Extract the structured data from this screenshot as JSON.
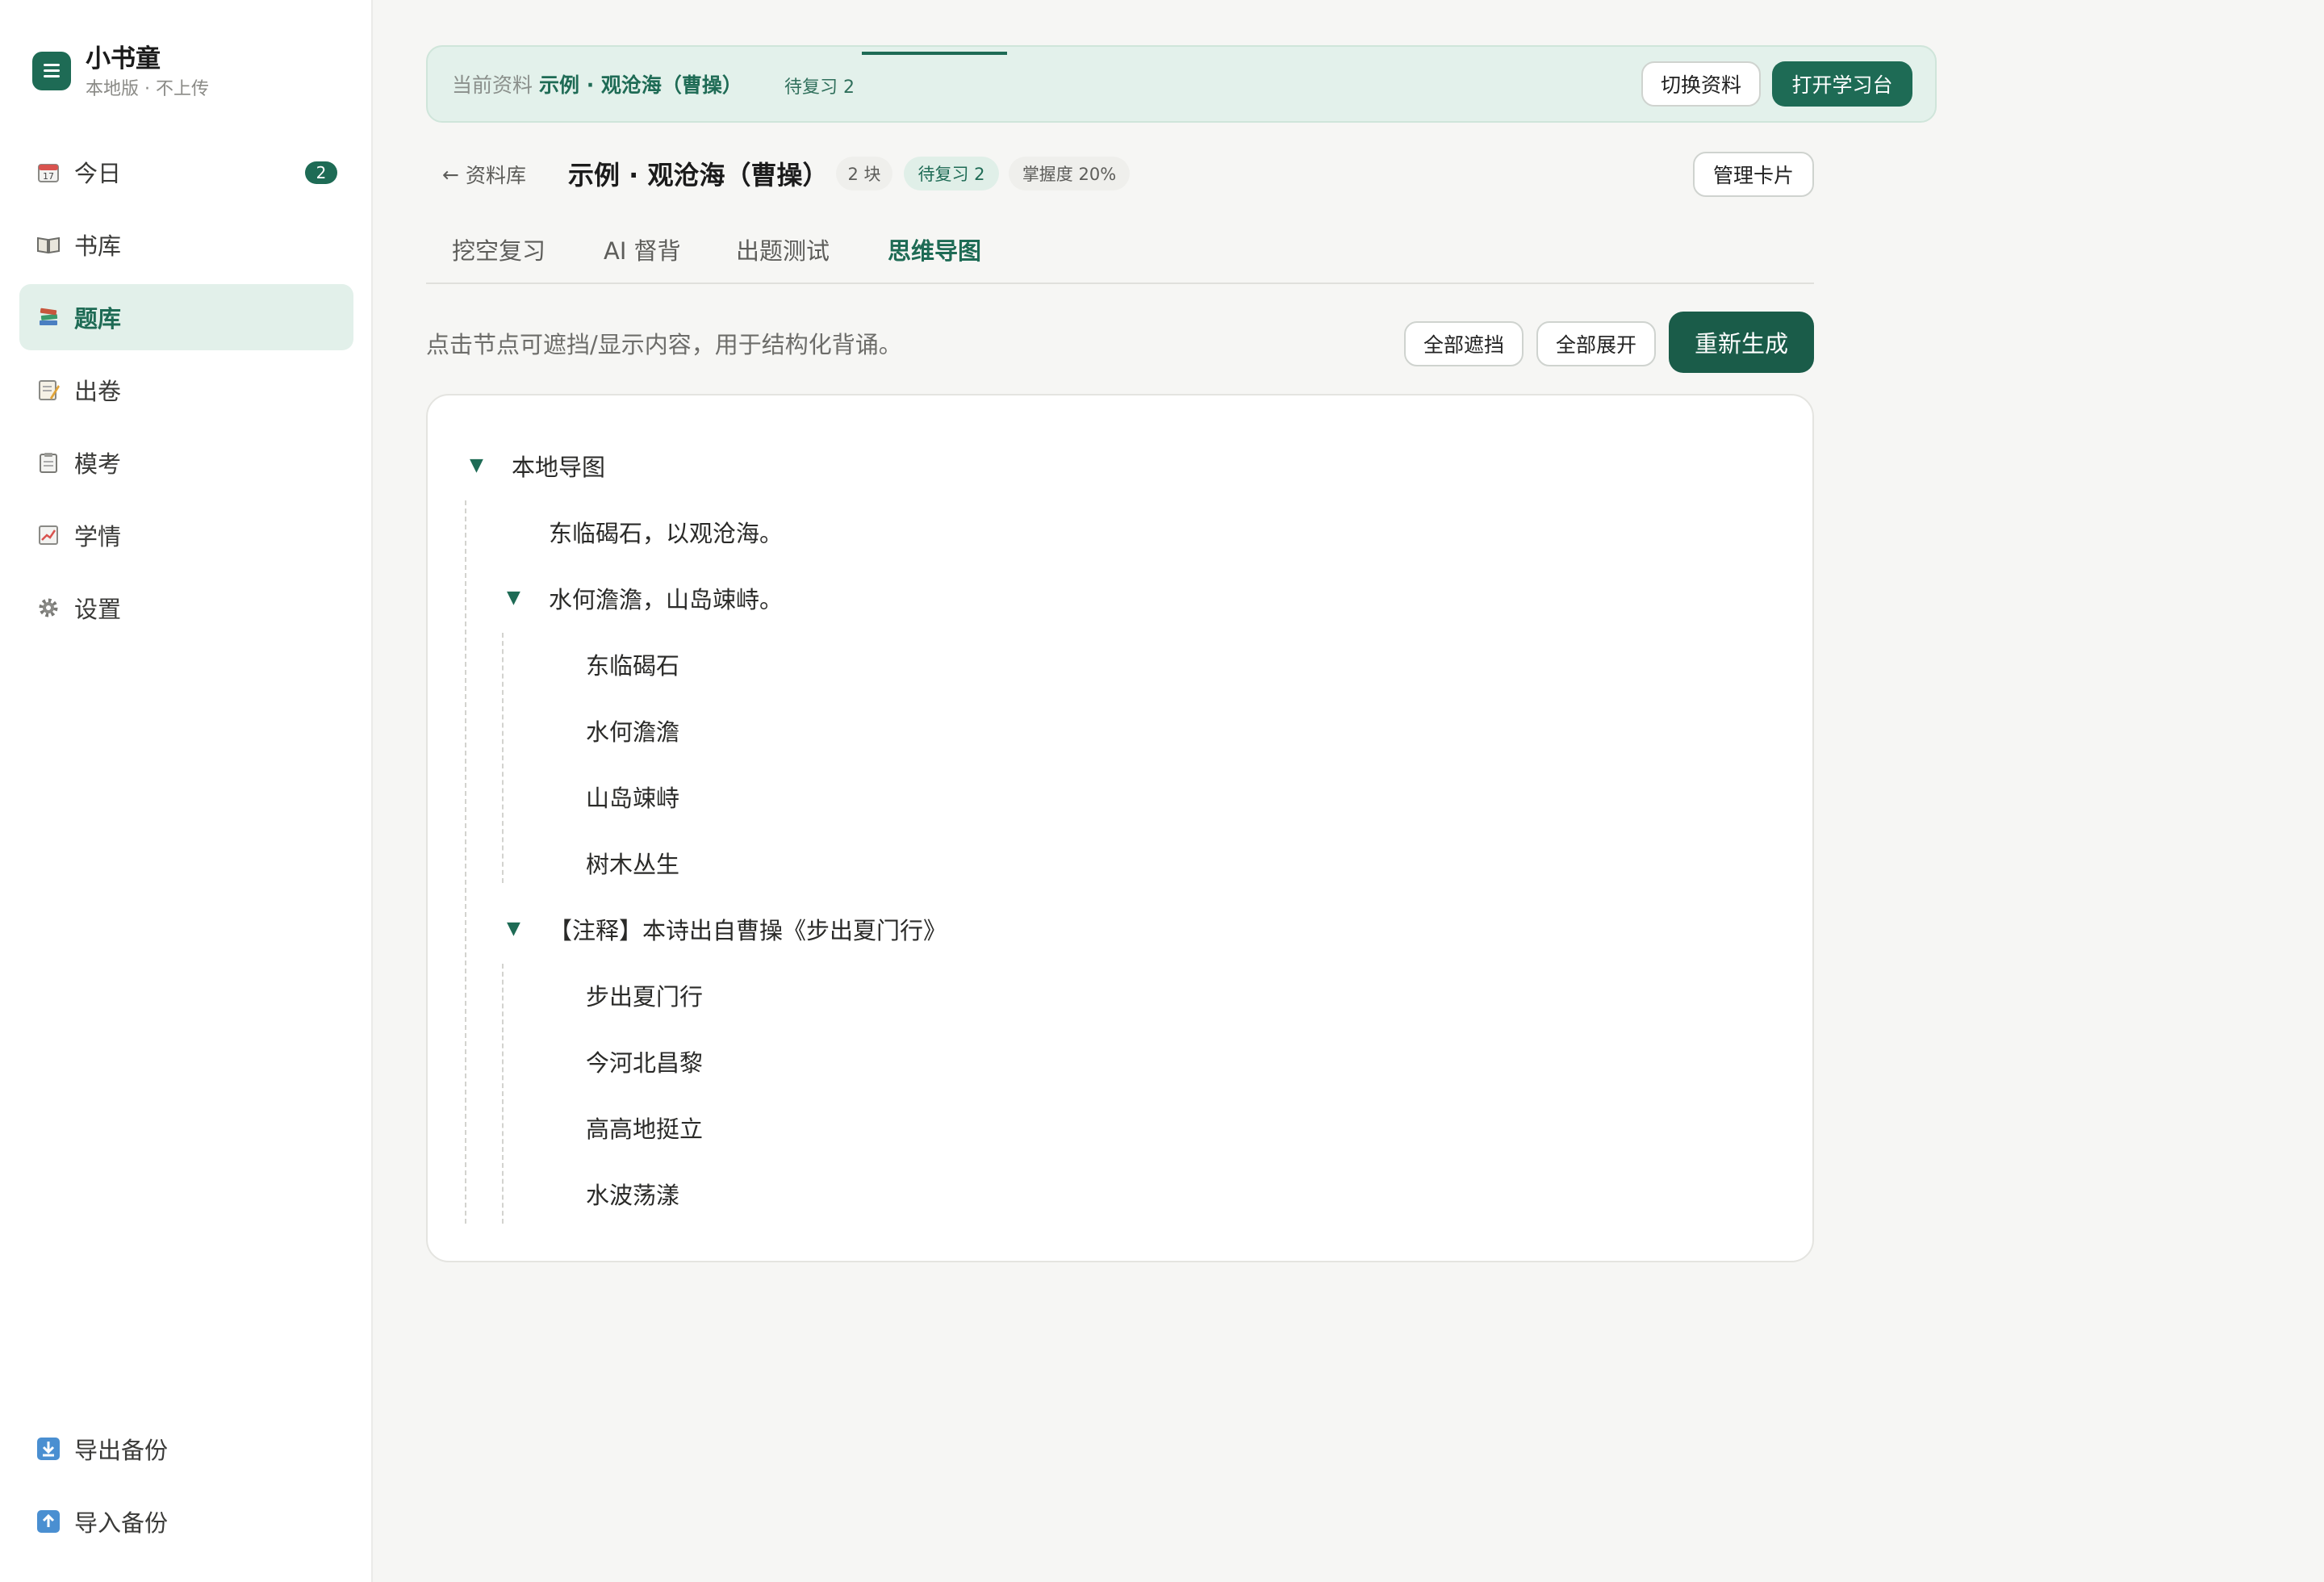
{
  "brand": {
    "title": "小书童",
    "subtitle": "本地版 · 不上传"
  },
  "sidebar": {
    "items": [
      {
        "label": "今日",
        "icon": "calendar-icon",
        "badge": "2"
      },
      {
        "label": "书库",
        "icon": "book-icon"
      },
      {
        "label": "题库",
        "icon": "books-stack-icon",
        "active": true
      },
      {
        "label": "出卷",
        "icon": "memo-icon"
      },
      {
        "label": "模考",
        "icon": "clipboard-icon"
      },
      {
        "label": "学情",
        "icon": "chart-icon"
      },
      {
        "label": "设置",
        "icon": "gear-icon"
      }
    ],
    "bottom": [
      {
        "label": "导出备份",
        "icon": "download-icon"
      },
      {
        "label": "导入备份",
        "icon": "upload-icon"
      }
    ]
  },
  "banner": {
    "label": "当前资料",
    "material_name": "示例 · 观沧海（曹操）",
    "pending": "待复习 2",
    "switch_label": "切换资料",
    "open_label": "打开学习台"
  },
  "header": {
    "back_label": "资料库",
    "title": "示例 · 观沧海（曹操）",
    "chips": {
      "blocks": "2 块",
      "pending": "待复习 2",
      "mastery": "掌握度 20%"
    },
    "manage_label": "管理卡片"
  },
  "tabs": [
    "挖空复习",
    "AI 督背",
    "出题测试",
    "思维导图"
  ],
  "active_tab": "思维导图",
  "toolbar": {
    "hint": "点击节点可遮挡/显示内容，用于结构化背诵。",
    "mask_all": "全部遮挡",
    "expand_all": "全部展开",
    "regenerate": "重新生成"
  },
  "mindmap": {
    "root": "本地导图",
    "children": [
      {
        "text": "东临碣石，以观沧海。"
      },
      {
        "text": "水何澹澹，山岛竦峙。",
        "children": [
          "东临碣石",
          "水何澹澹",
          "山岛竦峙",
          "树木丛生"
        ]
      },
      {
        "text": "【注释】本诗出自曹操《步出夏门行》",
        "children": [
          "步出夏门行",
          "今河北昌黎",
          "高高地挺立",
          "水波荡漾"
        ]
      }
    ]
  },
  "colors": {
    "accent": "#1e6b55",
    "accent_light": "#e2f0ea",
    "banner_bg": "#e3f1eb"
  }
}
